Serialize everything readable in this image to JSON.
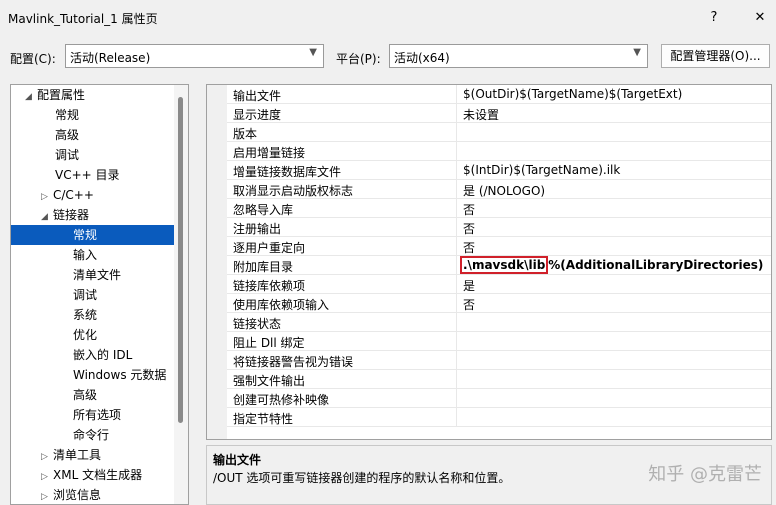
{
  "window": {
    "title": "Mavlink_Tutorial_1 属性页",
    "help": "?",
    "close": "✕"
  },
  "toolbar": {
    "config_label": "配置(C):",
    "config_value": "活动(Release)",
    "platform_label": "平台(P):",
    "platform_value": "活动(x64)",
    "manager_button": "配置管理器(O)..."
  },
  "tree": {
    "items": [
      {
        "label": "配置属性",
        "expander": "◢"
      },
      {
        "label": "常规",
        "expander": ""
      },
      {
        "label": "高级",
        "expander": ""
      },
      {
        "label": "调试",
        "expander": ""
      },
      {
        "label": "VC++ 目录",
        "expander": ""
      },
      {
        "label": "C/C++",
        "expander": "▷"
      },
      {
        "label": "链接器",
        "expander": "◢"
      },
      {
        "label": "常规",
        "expander": ""
      },
      {
        "label": "输入",
        "expander": ""
      },
      {
        "label": "清单文件",
        "expander": ""
      },
      {
        "label": "调试",
        "expander": ""
      },
      {
        "label": "系统",
        "expander": ""
      },
      {
        "label": "优化",
        "expander": ""
      },
      {
        "label": "嵌入的 IDL",
        "expander": ""
      },
      {
        "label": "Windows 元数据",
        "expander": ""
      },
      {
        "label": "高级",
        "expander": ""
      },
      {
        "label": "所有选项",
        "expander": ""
      },
      {
        "label": "命令行",
        "expander": ""
      },
      {
        "label": "清单工具",
        "expander": "▷"
      },
      {
        "label": "XML 文档生成器",
        "expander": "▷"
      },
      {
        "label": "浏览信息",
        "expander": "▷"
      }
    ]
  },
  "grid": {
    "rows": [
      {
        "name": "输出文件",
        "value": "$(OutDir)$(TargetName)$(TargetExt)"
      },
      {
        "name": "显示进度",
        "value": "未设置"
      },
      {
        "name": "版本",
        "value": ""
      },
      {
        "name": "启用增量链接",
        "value": ""
      },
      {
        "name": "增量链接数据库文件",
        "value": "$(IntDir)$(TargetName).ilk"
      },
      {
        "name": "取消显示启动版权标志",
        "value": "是 (/NOLOGO)"
      },
      {
        "name": "忽略导入库",
        "value": "否"
      },
      {
        "name": "注册输出",
        "value": "否"
      },
      {
        "name": "逐用户重定向",
        "value": "否"
      },
      {
        "name": "附加库目录",
        "value": ""
      },
      {
        "name": "链接库依赖项",
        "value": "是"
      },
      {
        "name": "使用库依赖项输入",
        "value": "否"
      },
      {
        "name": "链接状态",
        "value": ""
      },
      {
        "name": "阻止 Dll 绑定",
        "value": ""
      },
      {
        "name": "将链接器警告视为错误",
        "value": ""
      },
      {
        "name": "强制文件输出",
        "value": ""
      },
      {
        "name": "创建可热修补映像",
        "value": ""
      },
      {
        "name": "指定节特性",
        "value": ""
      }
    ],
    "lib_dir_highlight": ".\\mavsdk\\lib",
    "lib_dir_rest": "%(AdditionalLibraryDirectories)"
  },
  "description": {
    "title": "输出文件",
    "text": "/OUT 选项可重写链接器创建的程序的默认名称和位置。"
  },
  "watermark": "知乎 @克雷芒"
}
